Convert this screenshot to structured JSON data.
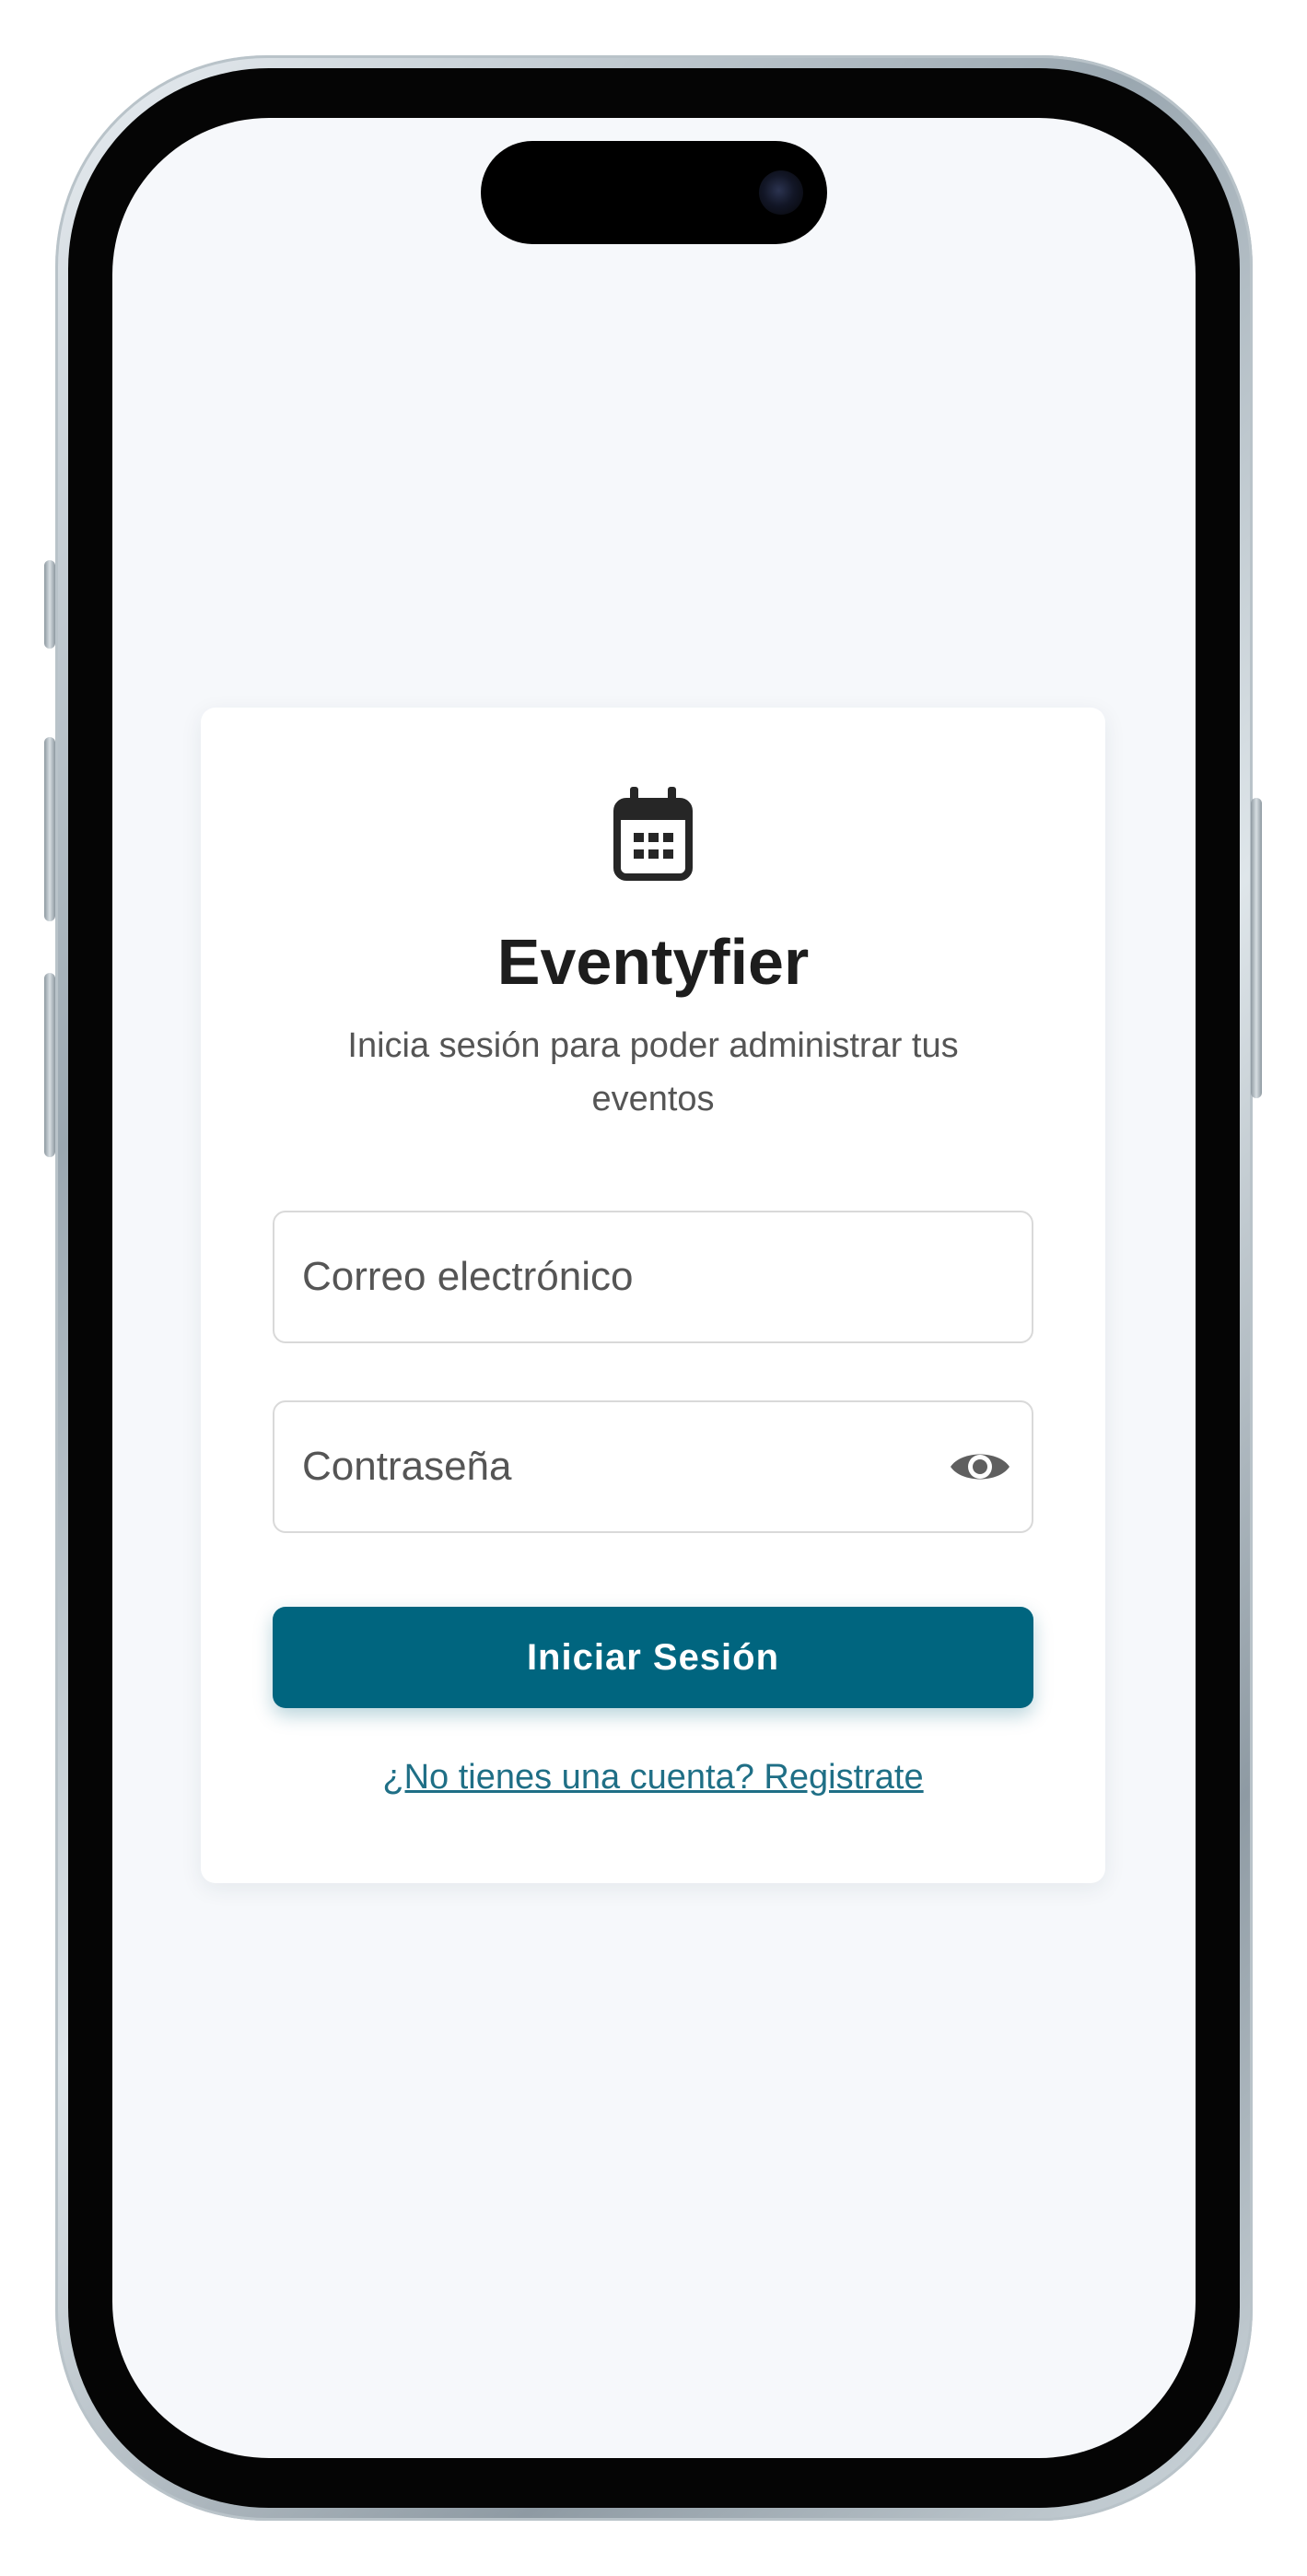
{
  "app": {
    "title": "Eventyfier",
    "subtitle": "Inicia sesión para poder administrar tus eventos",
    "logo_icon": "calendar-icon"
  },
  "form": {
    "email_placeholder": "Correo electrónico",
    "password_placeholder": "Contraseña",
    "toggle_password_icon": "eye-icon",
    "submit_label": "Iniciar Sesión",
    "register_link": "¿No tienes una cuenta? Registrate"
  },
  "colors": {
    "accent": "#00657f",
    "link": "#1f6f86",
    "background": "#f6f8fb",
    "card": "#ffffff"
  }
}
